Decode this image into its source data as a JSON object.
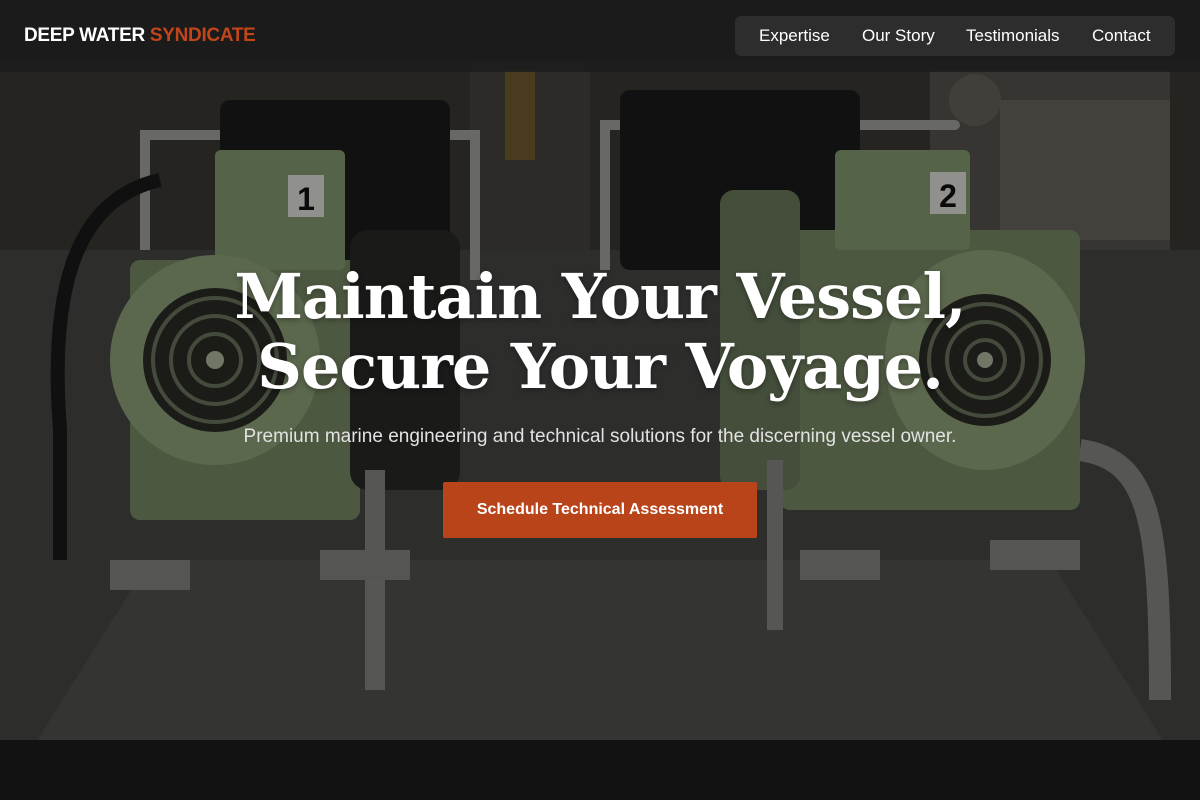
{
  "brand": {
    "name_primary": "DEEP WATER",
    "name_accent": "SYNDICATE",
    "accent_color": "#c0461a"
  },
  "nav": {
    "items": [
      {
        "label": "Expertise"
      },
      {
        "label": "Our Story"
      },
      {
        "label": "Testimonials"
      },
      {
        "label": "Contact"
      }
    ]
  },
  "hero": {
    "headline_line1": "Maintain Your Vessel,",
    "headline_line2": "Secure Your Voyage.",
    "subheadline": "Premium marine engineering and technical solutions for the discerning vessel owner.",
    "cta_label": "Schedule Technical Assessment",
    "cta_color": "#b9441a",
    "background_image": "engine-room-twin-green-motors-photo",
    "motor_labels": [
      "1",
      "2"
    ]
  }
}
